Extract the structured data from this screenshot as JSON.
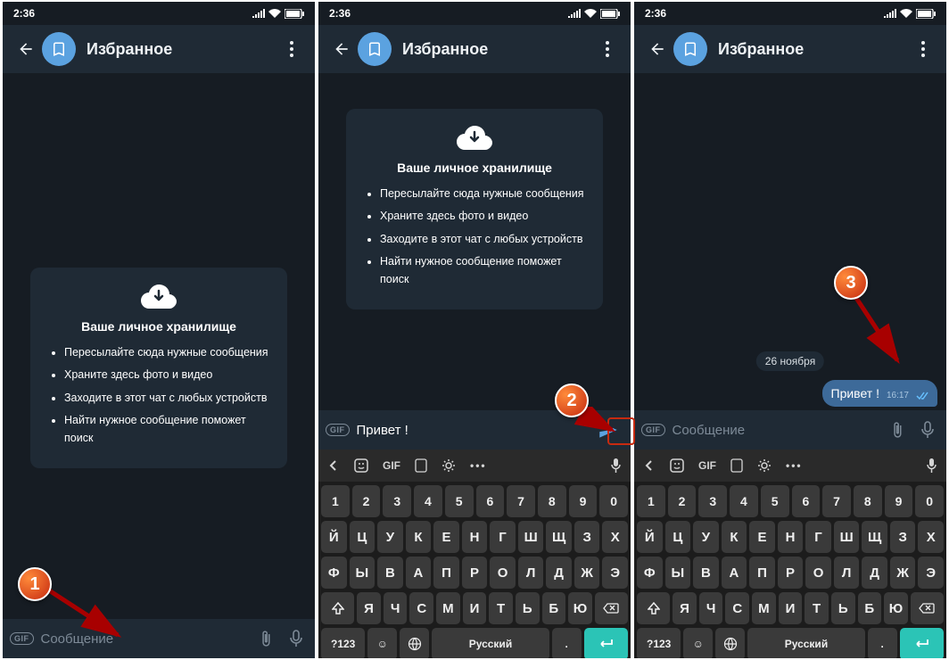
{
  "status": {
    "time": "2:36"
  },
  "appbar": {
    "title": "Избранное"
  },
  "card": {
    "title": "Ваше личное хранилище",
    "items": [
      "Пересылайте сюда нужные сообщения",
      "Храните здесь фото и видео",
      "Заходите в этот чат с любых устройств",
      "Найти нужное сообщение поможет поиск"
    ]
  },
  "input": {
    "placeholder": "Сообщение",
    "typed": "Привет !"
  },
  "message": {
    "date": "26 ноября",
    "text": "Привет !",
    "time": "16:17"
  },
  "keyboard": {
    "toolbar_gif": "GIF",
    "row_num": [
      "1",
      "2",
      "3",
      "4",
      "5",
      "6",
      "7",
      "8",
      "9",
      "0"
    ],
    "row1": [
      "Й",
      "Ц",
      "У",
      "К",
      "Е",
      "Н",
      "Г",
      "Ш",
      "Щ",
      "З",
      "Х"
    ],
    "row2": [
      "Ф",
      "Ы",
      "В",
      "А",
      "П",
      "Р",
      "О",
      "Л",
      "Д",
      "Ж",
      "Э"
    ],
    "row3": [
      "Я",
      "Ч",
      "С",
      "М",
      "И",
      "Т",
      "Ь",
      "Б",
      "Ю"
    ],
    "symbols": "?123",
    "lang": "Русский"
  },
  "badges": {
    "b1": "1",
    "b2": "2",
    "b3": "3"
  }
}
